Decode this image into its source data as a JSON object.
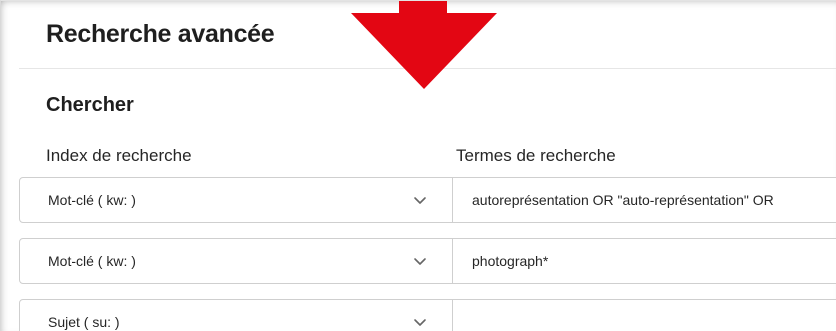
{
  "page": {
    "title": "Recherche avancée",
    "section_title": "Chercher"
  },
  "columns": {
    "index_label": "Index de recherche",
    "terms_label": "Termes de recherche"
  },
  "rows": [
    {
      "index": "Mot-clé ( kw: )",
      "terms": "autoreprésentation OR \"auto-représentation\" OR"
    },
    {
      "index": "Mot-clé ( kw: )",
      "terms": "photograph*"
    },
    {
      "index": "Sujet ( su: )",
      "terms": ""
    }
  ],
  "icons": {
    "dropdown": "chevron-down-icon",
    "annotation": "arrow-down-icon"
  },
  "colors": {
    "annotation_arrow": "#e30613",
    "text": "#262626",
    "border": "#cfcfcf"
  }
}
